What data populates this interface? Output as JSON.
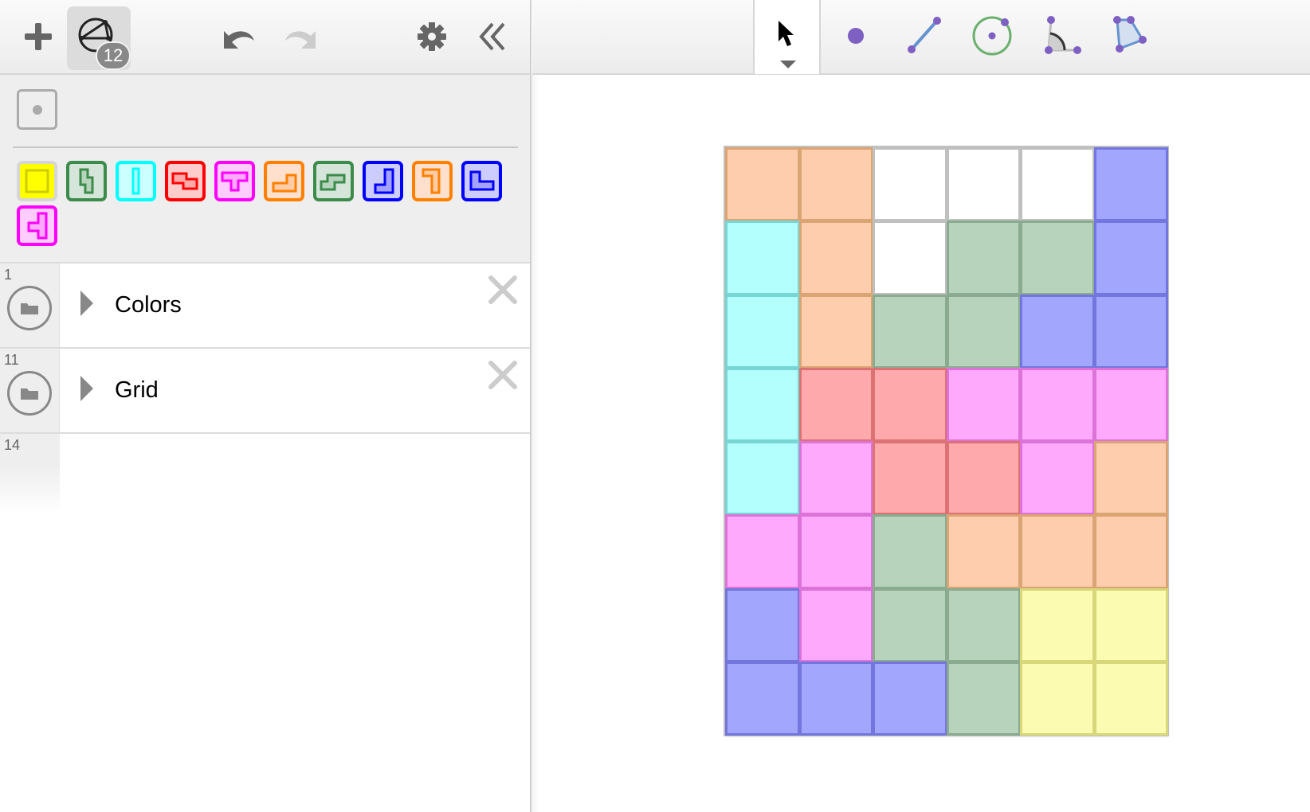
{
  "toolbar_left": {
    "add_icon": "plus-icon",
    "tools_icon": "geometry-tools-icon",
    "tools_badge": "12",
    "undo_icon": "undo-icon",
    "redo_icon": "redo-icon",
    "settings_icon": "gear-icon",
    "collapse_icon": "double-chevron-left-icon"
  },
  "toolbar_right": {
    "tools": [
      {
        "name": "move",
        "icon": "arrow-cursor-icon",
        "selected": true
      },
      {
        "name": "point",
        "icon": "point-icon"
      },
      {
        "name": "segment",
        "icon": "segment-icon"
      },
      {
        "name": "circle",
        "icon": "circle-center-point-icon"
      },
      {
        "name": "angle",
        "icon": "angle-icon"
      },
      {
        "name": "polygon",
        "icon": "polygon-icon"
      }
    ]
  },
  "controls": {
    "checkbox_checked": false,
    "palette": [
      {
        "piece": "O",
        "stroke": "#d6d6d6",
        "fill": "#ffff00",
        "inner": "#cccc00",
        "selected": true
      },
      {
        "piece": "S",
        "stroke": "#3b8b4a",
        "fill": "#d5e5d9",
        "inner": "#b8d4bc"
      },
      {
        "piece": "I",
        "stroke": "#00ffff",
        "fill": "#ccffff",
        "inner": "#b3ffff"
      },
      {
        "piece": "Z",
        "stroke": "#ff0000",
        "fill": "#ffcccc",
        "inner": "#ffaaaa"
      },
      {
        "piece": "T",
        "stroke": "#ff00ff",
        "fill": "#ffccff",
        "inner": "#ffaaff"
      },
      {
        "piece": "L",
        "stroke": "#ff8000",
        "fill": "#ffe0cc",
        "inner": "#ffcca8"
      },
      {
        "piece": "S2",
        "stroke": "#3b8b4a",
        "fill": "#d5e5d9",
        "inner": "#b8d4bc"
      },
      {
        "piece": "J",
        "stroke": "#0000ff",
        "fill": "#ccccff",
        "inner": "#a3a3ff"
      },
      {
        "piece": "L2",
        "stroke": "#ff8000",
        "fill": "#ffe0cc",
        "inner": "#ffcca8"
      },
      {
        "piece": "J2",
        "stroke": "#0000ff",
        "fill": "#ccccff",
        "inner": "#a3a3ff"
      },
      {
        "piece": "T2",
        "stroke": "#ff00ff",
        "fill": "#ffccff",
        "inner": "#ffaaff"
      }
    ]
  },
  "algebra": {
    "rows": [
      {
        "number": "1",
        "label": "Colors",
        "type": "folder",
        "expanded": false
      },
      {
        "number": "11",
        "label": "Grid",
        "type": "folder",
        "expanded": false
      },
      {
        "number": "14",
        "label": "",
        "type": "input"
      }
    ]
  },
  "board": {
    "columns": 6,
    "rows": 8,
    "colors": {
      "orange": {
        "fill": "#fecdae",
        "stroke": "#dba473"
      },
      "blue": {
        "fill": "#a3a6fd",
        "stroke": "#7376dc"
      },
      "cyan": {
        "fill": "#b2fffe",
        "stroke": "#75d6d4"
      },
      "green": {
        "fill": "#b7d3bc",
        "stroke": "#8aab90"
      },
      "red": {
        "fill": "#fea9ab",
        "stroke": "#dc7273"
      },
      "magenta": {
        "fill": "#fea9fc",
        "stroke": "#dc73d8"
      },
      "yellow": {
        "fill": "#fcfbb2",
        "stroke": "#d8d779"
      },
      "empty": {
        "fill": "#ffffff",
        "stroke": "#c0c0c0"
      }
    },
    "cells": [
      [
        "orange",
        "orange",
        "empty",
        "empty",
        "empty",
        "blue"
      ],
      [
        "cyan",
        "orange",
        "empty",
        "green",
        "green",
        "blue"
      ],
      [
        "cyan",
        "orange",
        "green",
        "green",
        "blue",
        "blue"
      ],
      [
        "cyan",
        "red",
        "red",
        "magenta",
        "magenta",
        "magenta"
      ],
      [
        "cyan",
        "magenta",
        "red",
        "red",
        "magenta",
        "orange"
      ],
      [
        "magenta",
        "magenta",
        "green",
        "orange",
        "orange",
        "orange"
      ],
      [
        "blue",
        "magenta",
        "green",
        "green",
        "yellow",
        "yellow"
      ],
      [
        "blue",
        "blue",
        "blue",
        "green",
        "yellow",
        "yellow"
      ]
    ]
  }
}
